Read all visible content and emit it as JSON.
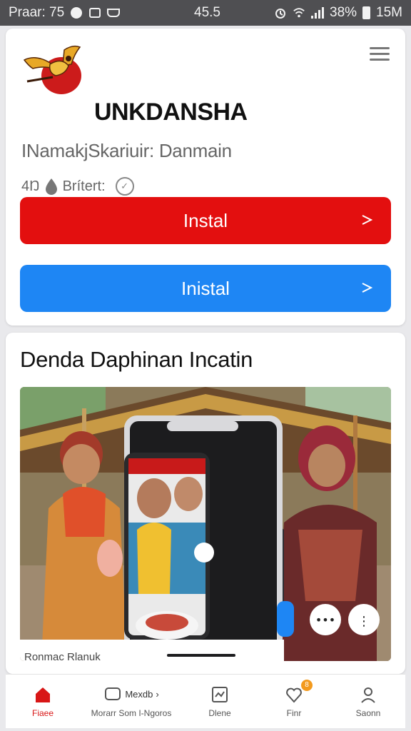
{
  "status_bar": {
    "left_text": "Praar: 75",
    "center_text": "45.5",
    "battery_text": "38%",
    "time_text": "15M"
  },
  "app": {
    "name": "UNKDANSHA",
    "developer": "INamakjSkariuir: Danmain",
    "meta_prefix": "4Ŋ",
    "meta_label": "Brítert:",
    "logo_icon": "winged-emblem-icon",
    "menu_icon": "hamburger-menu-icon"
  },
  "buttons": {
    "primary_label": "Instal",
    "secondary_label": "Inistal",
    "primary_color": "#e30f0f",
    "secondary_color": "#1e86f4"
  },
  "feature": {
    "title": "Denda Daphinan Incatin",
    "caption": "Ronmac Rlanuk"
  },
  "bottom_nav": {
    "items": [
      {
        "label": "Fiaee",
        "icon": "home-icon"
      },
      {
        "label": "Morarr Som I-Ngoros",
        "top_label": "Mexdb",
        "icon": "chat-bubble-icon"
      },
      {
        "label": "Dlene",
        "icon": "photo-frame-icon"
      },
      {
        "label": "Finr",
        "icon": "heart-icon",
        "badge": "8"
      },
      {
        "label": "Saonn",
        "icon": "person-icon"
      }
    ]
  },
  "colors": {
    "accent_red": "#d81616",
    "status_bar_bg": "#4f4f52",
    "badge": "#f39a1e"
  }
}
